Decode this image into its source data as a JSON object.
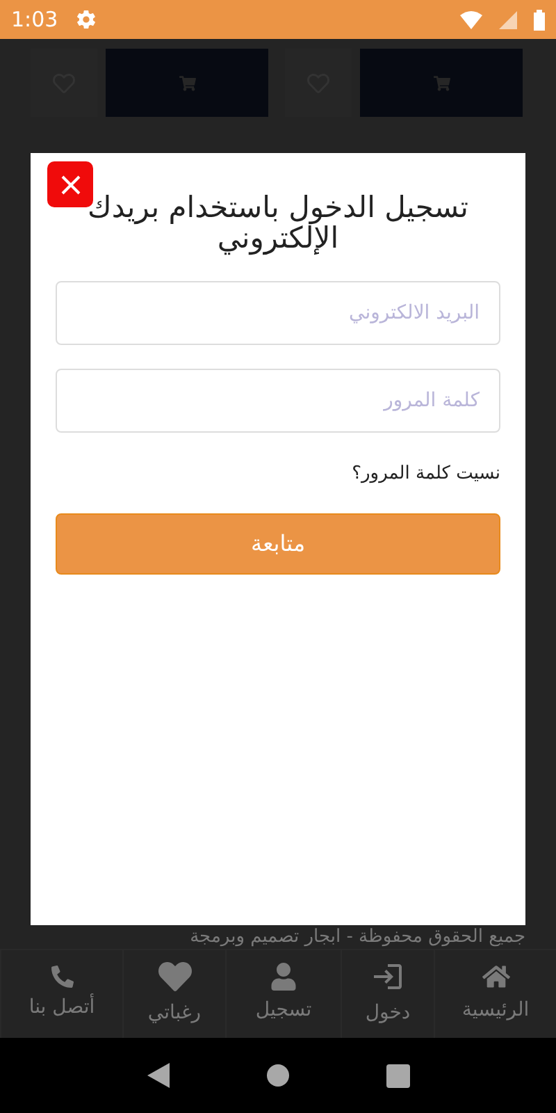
{
  "status_bar": {
    "time": "1:03"
  },
  "products": [
    {
      "kind": "card"
    },
    {
      "kind": "card"
    }
  ],
  "modal": {
    "title": "تسجيل الدخول باستخدام بريدك الإلكتروني",
    "email": {
      "placeholder": "البريد الالكتروني"
    },
    "password": {
      "placeholder": "كلمة المرور"
    },
    "forgot_link": "نسيت كلمة المرور؟",
    "submit_button": "متابعة"
  },
  "footer_text": "جميع الحقوق محفوظة - ابجار تصميم وبرمجة",
  "bottom_nav": [
    {
      "kind": "home",
      "label": "الرئيسية"
    },
    {
      "kind": "login",
      "label": "دخول"
    },
    {
      "kind": "register",
      "label": "تسجيل"
    },
    {
      "kind": "wishlist",
      "label": "رغباتي"
    },
    {
      "kind": "contact",
      "label": "أتصل بنا"
    }
  ]
}
